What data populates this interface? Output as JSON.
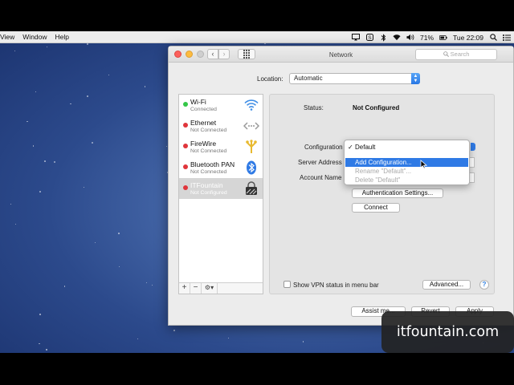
{
  "menubar": {
    "items": [
      "View",
      "Window",
      "Help"
    ],
    "status_icons": [
      "screen-mirror-icon",
      "skype-icon",
      "bluetooth-icon",
      "wifi-icon",
      "volume-icon"
    ],
    "battery": "71%",
    "clock": "Tue 22:09",
    "spotlight_icon": "search-icon",
    "list_icon": "notification-list-icon"
  },
  "window": {
    "title": "Network",
    "search_placeholder": "Search",
    "location_label": "Location:",
    "location_value": "Automatic"
  },
  "services": [
    {
      "name": "Wi-Fi",
      "status": "Connected",
      "dot_color": "#34c748",
      "icon": "wifi-icon"
    },
    {
      "name": "Ethernet",
      "status": "Not Connected",
      "dot_color": "#e0353b",
      "icon": "ethernet-icon"
    },
    {
      "name": "FireWire",
      "status": "Not Connected",
      "dot_color": "#e0353b",
      "icon": "firewire-icon"
    },
    {
      "name": "Bluetooth PAN",
      "status": "Not Connected",
      "dot_color": "#e0353b",
      "icon": "bluetooth-icon"
    },
    {
      "name": "ITFountain",
      "status": "Not Configured",
      "dot_color": "#e0353b",
      "icon": "vpn-lock-icon"
    }
  ],
  "sidebar_footer": {
    "add": "+",
    "remove": "−",
    "gear": "⚙▾"
  },
  "detail": {
    "status_label": "Status:",
    "status_value": "Not Configured",
    "configuration_label": "Configuration",
    "server_label": "Server Address",
    "account_label": "Account Name",
    "auth_button": "Authentication Settings...",
    "connect_button": "Connect",
    "show_vpn_label": "Show VPN status in menu bar",
    "advanced_button": "Advanced...",
    "help_button": "?"
  },
  "config_menu": {
    "items": [
      {
        "label": "Default",
        "checked": true,
        "state": "normal"
      },
      {
        "label": "Add Configuration...",
        "checked": false,
        "state": "highlighted"
      },
      {
        "label": "Rename \"Default\"...",
        "checked": false,
        "state": "disabled"
      },
      {
        "label": "Delete \"Default\"",
        "checked": false,
        "state": "disabled"
      }
    ]
  },
  "bottom_buttons": {
    "assist": "Assist me...",
    "revert": "Revert",
    "apply": "Apply"
  },
  "watermark": "itfountain.com",
  "colors": {
    "accent": "#2f7ae5",
    "connected": "#34c748",
    "not_connected": "#e0353b"
  }
}
